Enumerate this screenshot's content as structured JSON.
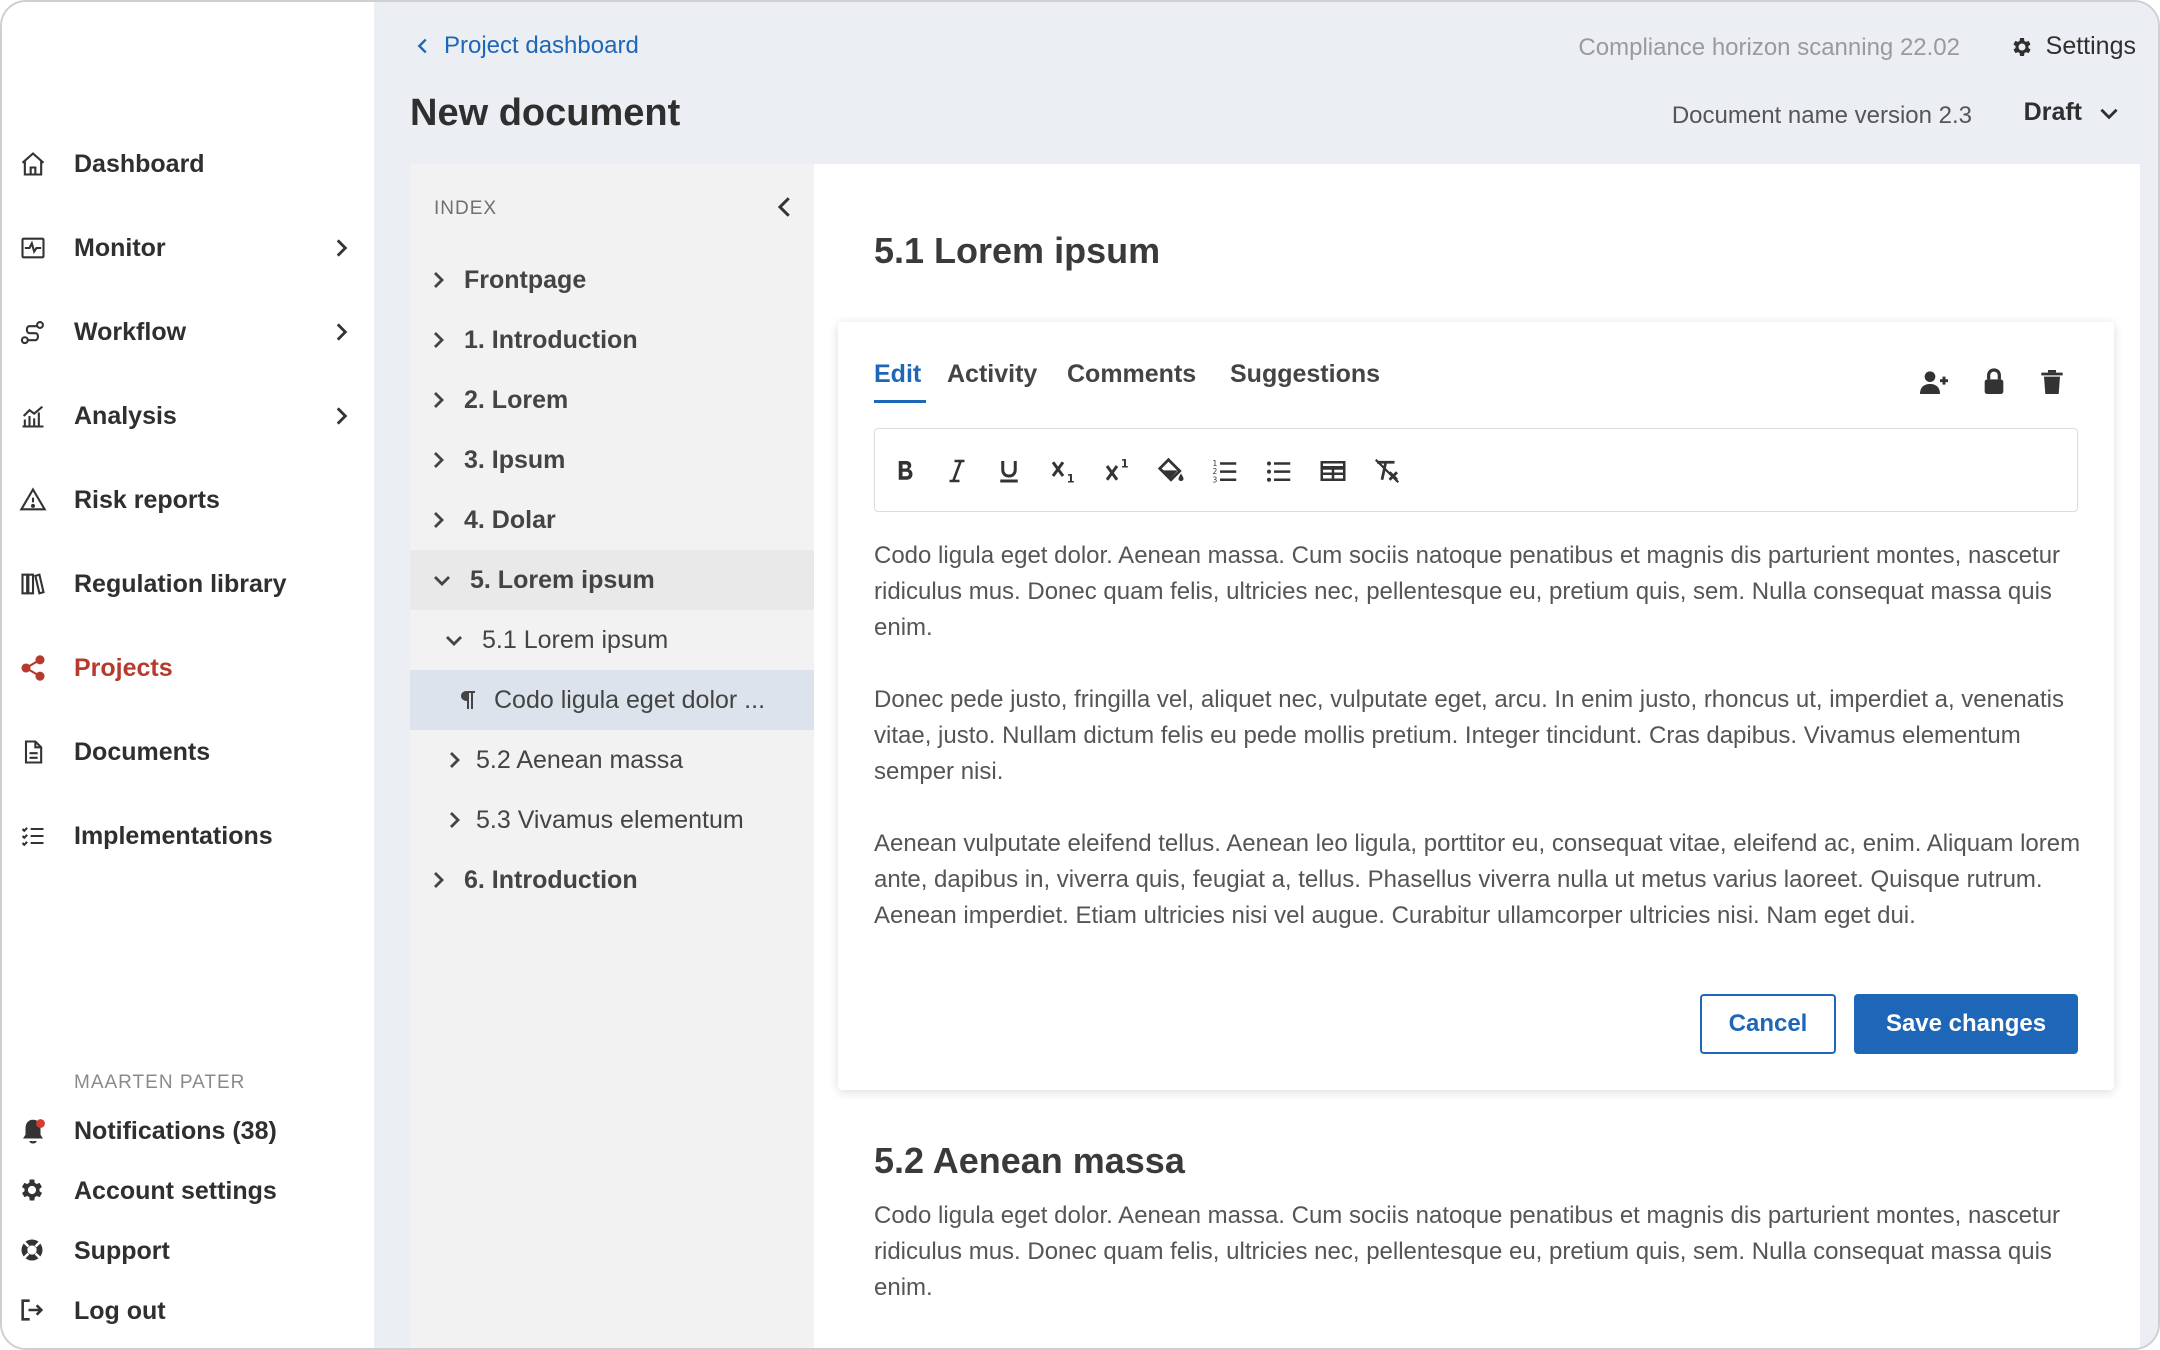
{
  "sidebar": {
    "nav": [
      {
        "label": "Dashboard",
        "icon": "home-icon",
        "has_children": false,
        "active": false
      },
      {
        "label": "Monitor",
        "icon": "monitor-icon",
        "has_children": true,
        "active": false
      },
      {
        "label": "Workflow",
        "icon": "workflow-icon",
        "has_children": true,
        "active": false
      },
      {
        "label": "Analysis",
        "icon": "analysis-icon",
        "has_children": true,
        "active": false
      },
      {
        "label": "Risk reports",
        "icon": "warning-icon",
        "has_children": false,
        "active": false
      },
      {
        "label": "Regulation library",
        "icon": "library-icon",
        "has_children": false,
        "active": false
      },
      {
        "label": "Projects",
        "icon": "share-icon",
        "has_children": false,
        "active": true
      },
      {
        "label": "Documents",
        "icon": "document-icon",
        "has_children": false,
        "active": false
      },
      {
        "label": "Implementations",
        "icon": "checklist-icon",
        "has_children": false,
        "active": false
      }
    ],
    "user_caption": "MAARTEN PATER",
    "bottom": [
      {
        "label": "Notifications (38)",
        "icon": "bell-icon"
      },
      {
        "label": "Account settings",
        "icon": "gear-icon"
      },
      {
        "label": "Support",
        "icon": "lifebuoy-icon"
      },
      {
        "label": "Log out",
        "icon": "logout-icon"
      }
    ]
  },
  "header": {
    "back_label": "Project dashboard",
    "scan_title": "Compliance horizon scanning 22.02",
    "settings_label": "Settings",
    "page_title": "New document",
    "doc_version": "Document name version 2.3",
    "status": "Draft"
  },
  "index": {
    "caption": "INDEX",
    "items": [
      {
        "label": "Frontpage"
      },
      {
        "label": "1. Introduction"
      },
      {
        "label": "2. Lorem"
      },
      {
        "label": "3. Ipsum"
      },
      {
        "label": "4. Dolar"
      },
      {
        "label": "5. Lorem ipsum"
      },
      {
        "label": "5.1 Lorem ipsum"
      },
      {
        "label": "Codo ligula eget dolor ..."
      },
      {
        "label": "5.2 Aenean massa"
      },
      {
        "label": "5.3 Vivamus elementum"
      },
      {
        "label": "6. Introduction"
      }
    ]
  },
  "content": {
    "section1_title": "5.1 Lorem ipsum",
    "tabs": [
      "Edit",
      "Activity",
      "Comments",
      "Suggestions"
    ],
    "toolbar": [
      "bold-icon",
      "italic-icon",
      "underline-icon",
      "subscript-icon",
      "superscript-icon",
      "fill-color-icon",
      "numbered-list-icon",
      "bullet-list-icon",
      "table-icon",
      "clear-format-icon"
    ],
    "paragraphs": [
      "Codo ligula eget dolor. Aenean massa. Cum sociis natoque penatibus et magnis dis parturient montes, nascetur ridiculus mus. Donec quam felis, ultricies nec, pellentesque eu, pretium quis, sem. Nulla consequat massa quis enim.",
      "Donec pede justo, fringilla vel, aliquet nec, vulputate eget, arcu. In enim justo, rhoncus ut, imperdiet a, venenatis vitae, justo. Nullam dictum felis eu pede mollis pretium. Integer tincidunt. Cras dapibus. Vivamus elementum semper nisi.",
      "Aenean vulputate eleifend tellus. Aenean leo ligula, porttitor eu, consequat vitae, eleifend ac, enim. Aliquam lorem ante, dapibus in, viverra quis, feugiat a, tellus. Phasellus viverra nulla ut metus varius laoreet. Quisque rutrum. Aenean imperdiet. Etiam ultricies nisi vel augue. Curabitur ullamcorper ultricies nisi. Nam eget dui."
    ],
    "cancel_label": "Cancel",
    "save_label": "Save changes",
    "section2_title": "5.2 Aenean massa",
    "section2_paragraph": "Codo ligula eget dolor. Aenean massa. Cum sociis natoque penatibus et magnis dis parturient montes, nascetur ridiculus mus. Donec quam felis, ultricies nec, pellentesque eu, pretium quis, sem. Nulla consequat massa quis enim."
  },
  "colors": {
    "accent": "#1e66b8",
    "active_nav": "#b73a2e",
    "notification_dot": "#d83a2b",
    "main_bg": "#ebeef3",
    "index_bg": "#f2f2f2",
    "index_selected": "#dde3ec"
  }
}
